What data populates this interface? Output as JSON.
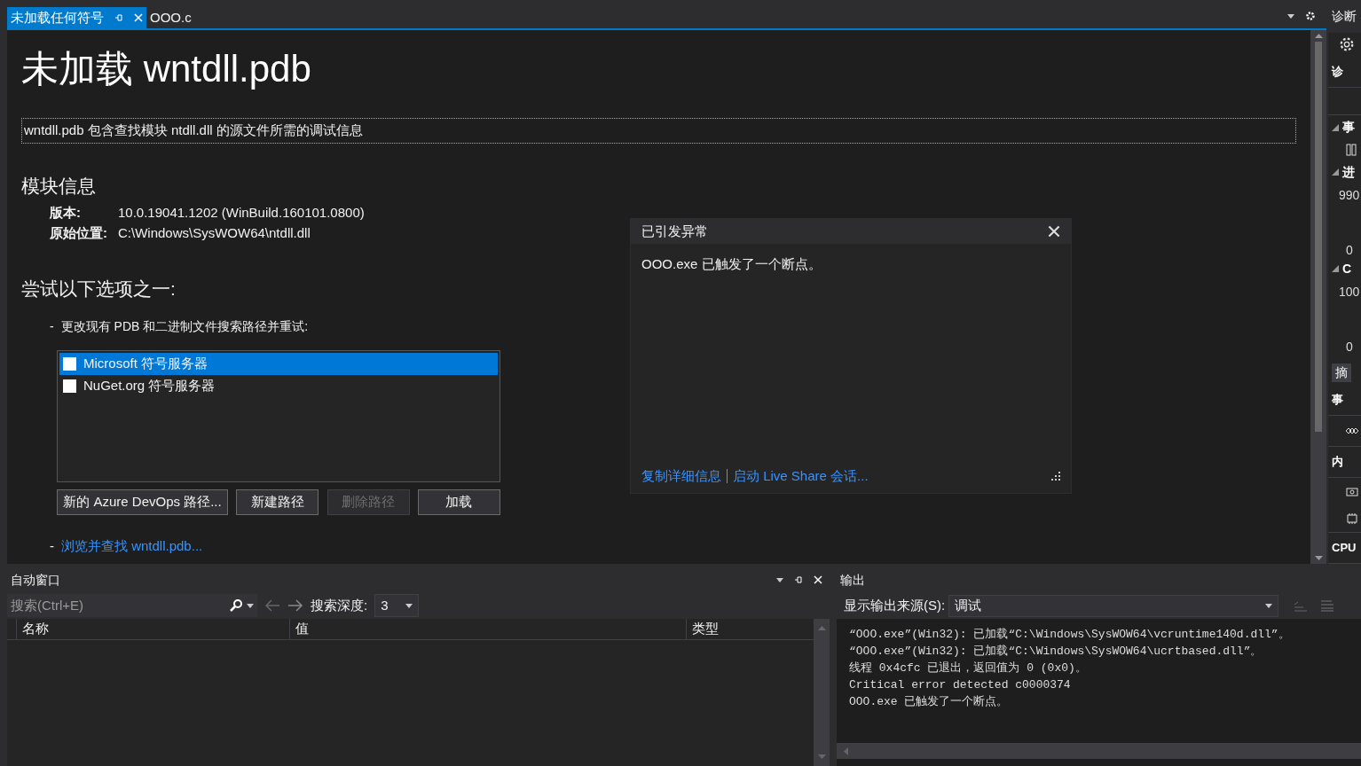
{
  "tabs": [
    {
      "label": "未加载任何符号",
      "selected": true
    },
    {
      "label": "OOO.c",
      "selected": false
    }
  ],
  "document": {
    "title": "未加载 wntdll.pdb",
    "description": "wntdll.pdb 包含查找模块 ntdll.dll 的源文件所需的调试信息",
    "module_heading": "模块信息",
    "module_info": [
      {
        "label": "版本:",
        "value": "10.0.19041.1202 (WinBuild.160101.0800)"
      },
      {
        "label": "原始位置:",
        "value": "C:\\Windows\\SysWOW64\\ntdll.dll"
      }
    ],
    "try_heading": "尝试以下选项之一:",
    "option_dash": "-",
    "option_text": "更改现有 PDB 和二进制文件搜索路径并重试:",
    "symbol_servers": [
      {
        "label": "Microsoft 符号服务器",
        "checked": false,
        "selected": true
      },
      {
        "label": "NuGet.org 符号服务器",
        "checked": false,
        "selected": false
      }
    ],
    "buttons": [
      {
        "label": "新的 Azure DevOps 路径...",
        "disabled": false
      },
      {
        "label": "新建路径",
        "disabled": false
      },
      {
        "label": "删除路径",
        "disabled": true
      },
      {
        "label": "加载",
        "disabled": false
      }
    ],
    "browse_dash": "-",
    "browse_link": "浏览并查找 wntdll.pdb..."
  },
  "exception_popup": {
    "title": "已引发异常",
    "message": "OOO.exe 已触发了一个断点。",
    "links": [
      "复制详细信息",
      "启动 Live Share 会话..."
    ]
  },
  "autos": {
    "title": "自动窗口",
    "search_placeholder": "搜索(Ctrl+E)",
    "depth_label": "搜索深度:",
    "depth_value": "3",
    "columns": [
      "名称",
      "值",
      "类型"
    ]
  },
  "output": {
    "title": "输出",
    "source_label": "显示输出来源(S):",
    "source_value": "调试",
    "lines": [
      "“OOO.exe”(Win32): 已加载“C:\\Windows\\SysWOW64\\vcruntime140d.dll”。",
      "“OOO.exe”(Win32): 已加载“C:\\Windows\\SysWOW64\\ucrtbased.dll”。",
      "线程 0x4cfc 已退出，返回值为 0 (0x0)。",
      "Critical error detected c0000374",
      "OOO.exe 已触发了一个断点。"
    ]
  },
  "diagnostics": {
    "title": "诊断",
    "items": [
      {
        "kind": "gear"
      },
      {
        "kind": "heading",
        "text": "诊"
      },
      {
        "kind": "spacer"
      },
      {
        "kind": "section",
        "text": "事"
      },
      {
        "kind": "bars"
      },
      {
        "kind": "section",
        "text": "进"
      },
      {
        "kind": "value",
        "text": "990"
      },
      {
        "kind": "axis",
        "text": "0"
      },
      {
        "kind": "section",
        "text": "C"
      },
      {
        "kind": "value",
        "text": "100"
      },
      {
        "kind": "axis",
        "text": "0"
      },
      {
        "kind": "tab",
        "text": "摘"
      },
      {
        "kind": "heading",
        "text": "事"
      },
      {
        "kind": "diamonds"
      },
      {
        "kind": "heading",
        "text": "内"
      },
      {
        "kind": "camera"
      },
      {
        "kind": "chip"
      },
      {
        "kind": "heading",
        "text": "CPU"
      }
    ]
  }
}
